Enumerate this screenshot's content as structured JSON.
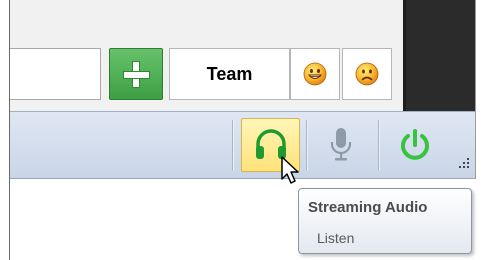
{
  "search": {
    "value": "",
    "placeholder": ""
  },
  "header": {
    "team_label": "Team"
  },
  "toolbar": {
    "headphones_state": "active",
    "headphones_color": "#1e9b2e",
    "mic_color": "#8f9aa8",
    "power_color": "#37c23f",
    "highlight_color": "#ffe27a"
  },
  "tooltip": {
    "title": "Streaming Audio",
    "body": "Listen"
  },
  "icons": [
    "plus-icon",
    "grin-face-icon",
    "frown-face-icon",
    "headphones-icon",
    "microphone-icon",
    "power-icon",
    "resize-grip-icon",
    "mouse-pointer-icon"
  ]
}
